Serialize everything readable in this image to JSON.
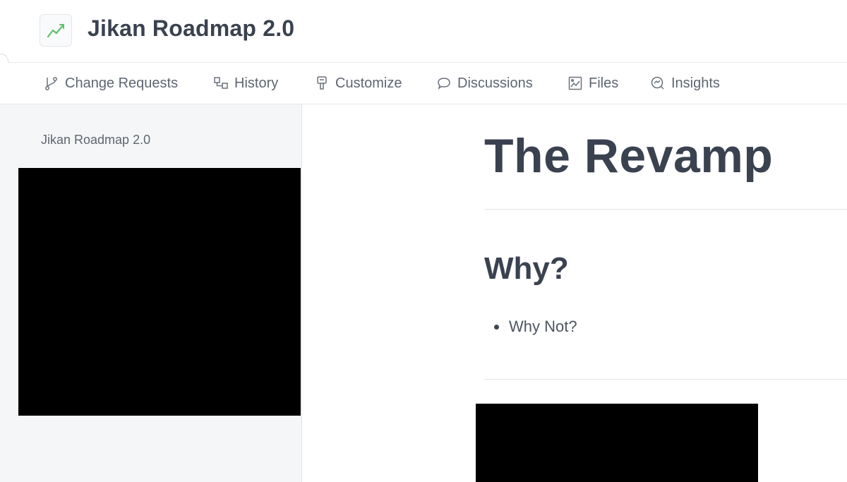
{
  "app": {
    "title": "Jikan Roadmap 2.0",
    "icon": "chart-trend-icon"
  },
  "tabs": [
    {
      "label": "Change Requests",
      "icon": "branch-icon"
    },
    {
      "label": "History",
      "icon": "history-icon"
    },
    {
      "label": "Customize",
      "icon": "brush-icon"
    },
    {
      "label": "Discussions",
      "icon": "chat-bubble-icon"
    },
    {
      "label": "Files",
      "icon": "image-file-icon"
    },
    {
      "label": "Insights",
      "icon": "insights-icon"
    }
  ],
  "sidebar": {
    "title": "Jikan Roadmap 2.0"
  },
  "page": {
    "title": "The Revamp",
    "section_heading": "Why?",
    "bullets": [
      "Why Not?"
    ]
  },
  "colors": {
    "text_dark": "#3a4250",
    "sidebar_bg": "#f5f6f8",
    "icon_green": "#5fbf6a",
    "redacted": "#000000"
  }
}
